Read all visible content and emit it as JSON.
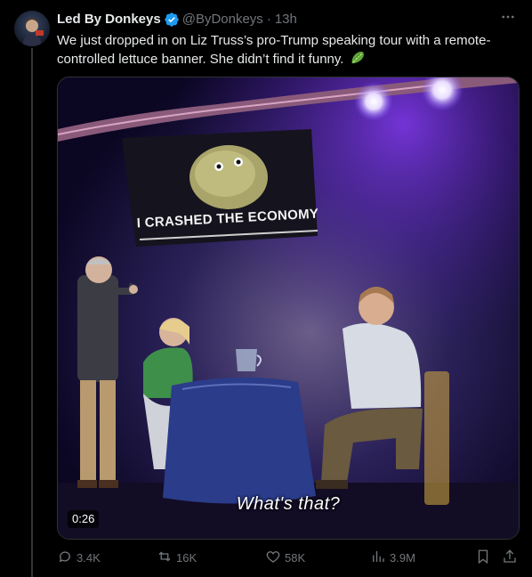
{
  "author": {
    "name": "Led By Donkeys",
    "handle": "@ByDonkeys",
    "separator": "·",
    "time": "13h"
  },
  "tweet": {
    "text": "We just dropped in on Liz Truss’s pro-Trump speaking tour with a remote-controlled lettuce banner. She didn’t find it funny."
  },
  "media": {
    "duration": "0:26",
    "subtitle": "What's that?",
    "banner_text": "I CRASHED THE ECONOMY"
  },
  "actions": {
    "replies": "3.4K",
    "reposts": "16K",
    "likes": "58K",
    "views": "3.9M"
  },
  "colors": {
    "accent": "#1d9bf0",
    "muted": "#71767b",
    "text": "#e7e9ea",
    "background": "#000000"
  },
  "icons": [
    "verified-badge-icon",
    "more-icon",
    "lettuce-emoji",
    "reply-icon",
    "repost-icon",
    "like-icon",
    "views-icon",
    "bookmark-icon",
    "share-icon"
  ]
}
